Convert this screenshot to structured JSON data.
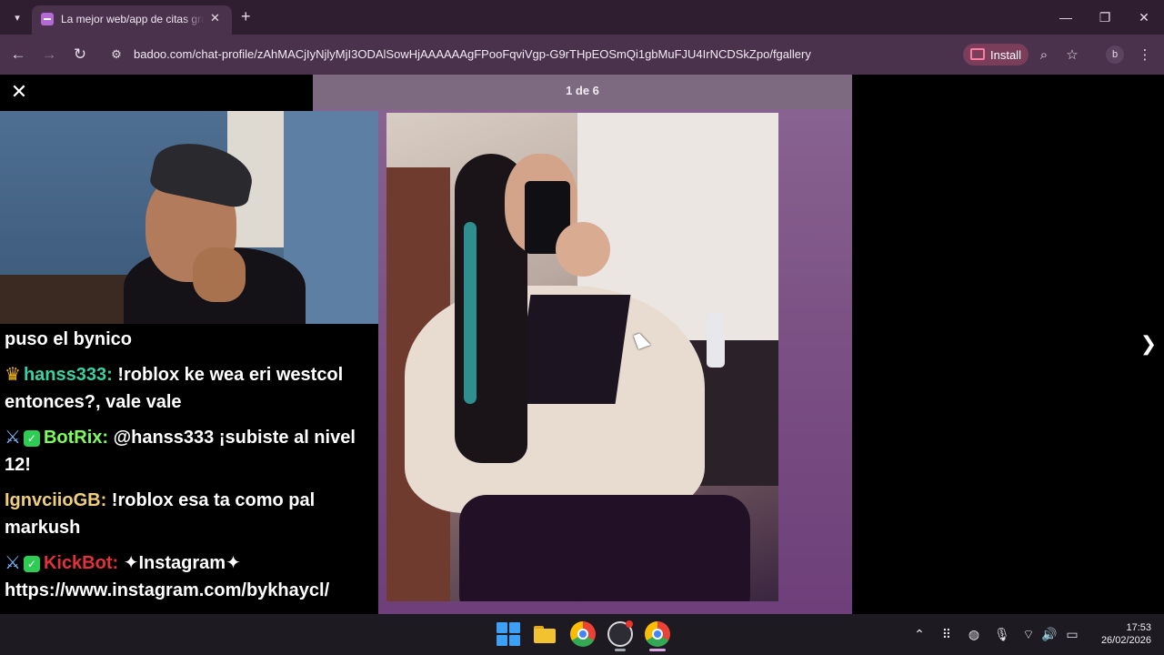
{
  "browser": {
    "tab": {
      "title": "La mejor web/app de citas grat"
    },
    "url": "badoo.com/chat-profile/zAhMACjIyNjlyMjI3ODAlSowHjAAAAAAgFPooFqviVgp-G9rTHpEOSmQi1gbMuFJU4IrNCDSkZpo/fgallery",
    "install_label": "Install",
    "profile_initial": "b"
  },
  "gallery": {
    "counter": "1 de 6"
  },
  "chat": {
    "lines": [
      {
        "text": "puso el bynico"
      },
      {
        "user": "hanss333:",
        "text": " !roblox ke wea eri westcol entonces?, vale vale"
      },
      {
        "user": "BotRix:",
        "text": " @hanss333 ¡subiste al nivel 12!"
      },
      {
        "user": "IgnvciioGB:",
        "text": " !roblox esa ta como pal markush"
      },
      {
        "user": "KickBot:",
        "text": " ✦Instagram✦ https://www.instagram.com/bykhaycl/"
      }
    ]
  },
  "taskbar": {
    "time": "17:53",
    "date": "26/02/2026"
  },
  "colors": {
    "tab_bg": "#2f1e30",
    "toolbar_bg": "#4a324c",
    "gallery_bg": "#7c5285",
    "user_hanss": "#39d0a2",
    "user_botrix": "#7cff5a",
    "user_ign": "#f2d07a",
    "user_kick": "#e3313b"
  }
}
